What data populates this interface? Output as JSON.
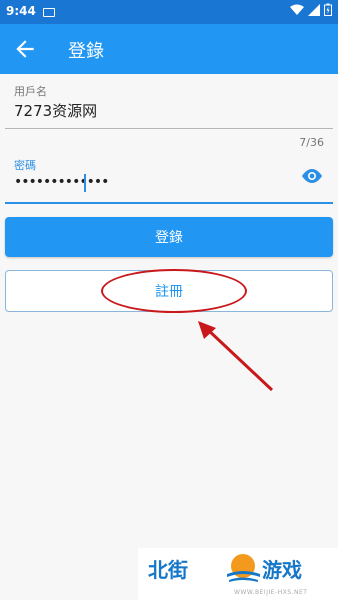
{
  "status": {
    "time": "9:44"
  },
  "appbar": {
    "title": "登錄"
  },
  "form": {
    "username_label": "用戶名",
    "username_value": "7273资源网",
    "password_label": "密碼",
    "password_value": "•••••••••••••",
    "counter": "7/36"
  },
  "buttons": {
    "login_label": "登錄",
    "register_label": "註冊"
  },
  "watermark": {
    "left_text": "北街",
    "right_text": "游戏",
    "url": "WWW.BEIJIE-HXS.NET"
  },
  "colors": {
    "primary": "#2196f3",
    "accent": "#2b8fe6",
    "annotation": "#c9181b"
  }
}
